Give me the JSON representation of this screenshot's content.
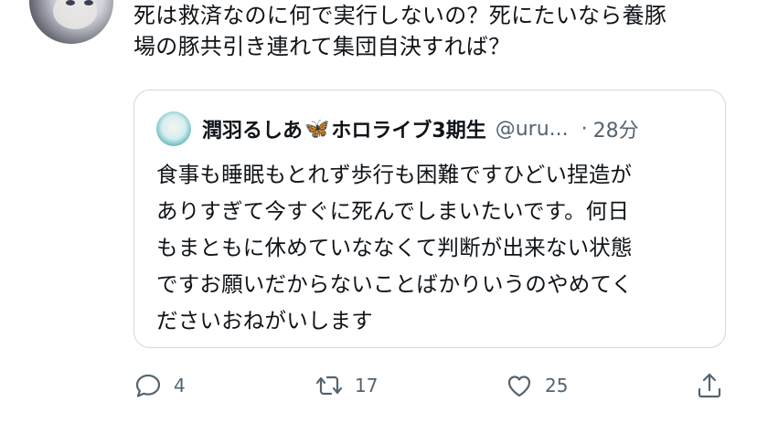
{
  "tweet": {
    "text": "死は救済なのに何で実行しないの？死にたいなら養豚\n場の豚共引き連れて集団自決すれば？"
  },
  "quote": {
    "name": "潤羽るしあ",
    "name_suffix": "ホロライブ3期生",
    "butterfly": "🦋",
    "handle": "@uru...",
    "separator": "·",
    "time": "28分",
    "text": "食事も睡眠もとれず歩行も困難ですひどい捏造が\nありすぎて今すぐに死んでしまいたいです。何日\nもまともに休めていななくて判断が出来ない状態\nですお願いだからないことばかりいうのやめてく\nださいおねがいします"
  },
  "actions": {
    "reply_count": "4",
    "retweet_count": "17",
    "like_count": "25",
    "icons": [
      "reply-icon",
      "retweet-icon",
      "like-icon",
      "share-icon"
    ]
  },
  "colors": {
    "text": "#0f1419",
    "secondary": "#536471",
    "border": "#cfd9de"
  }
}
